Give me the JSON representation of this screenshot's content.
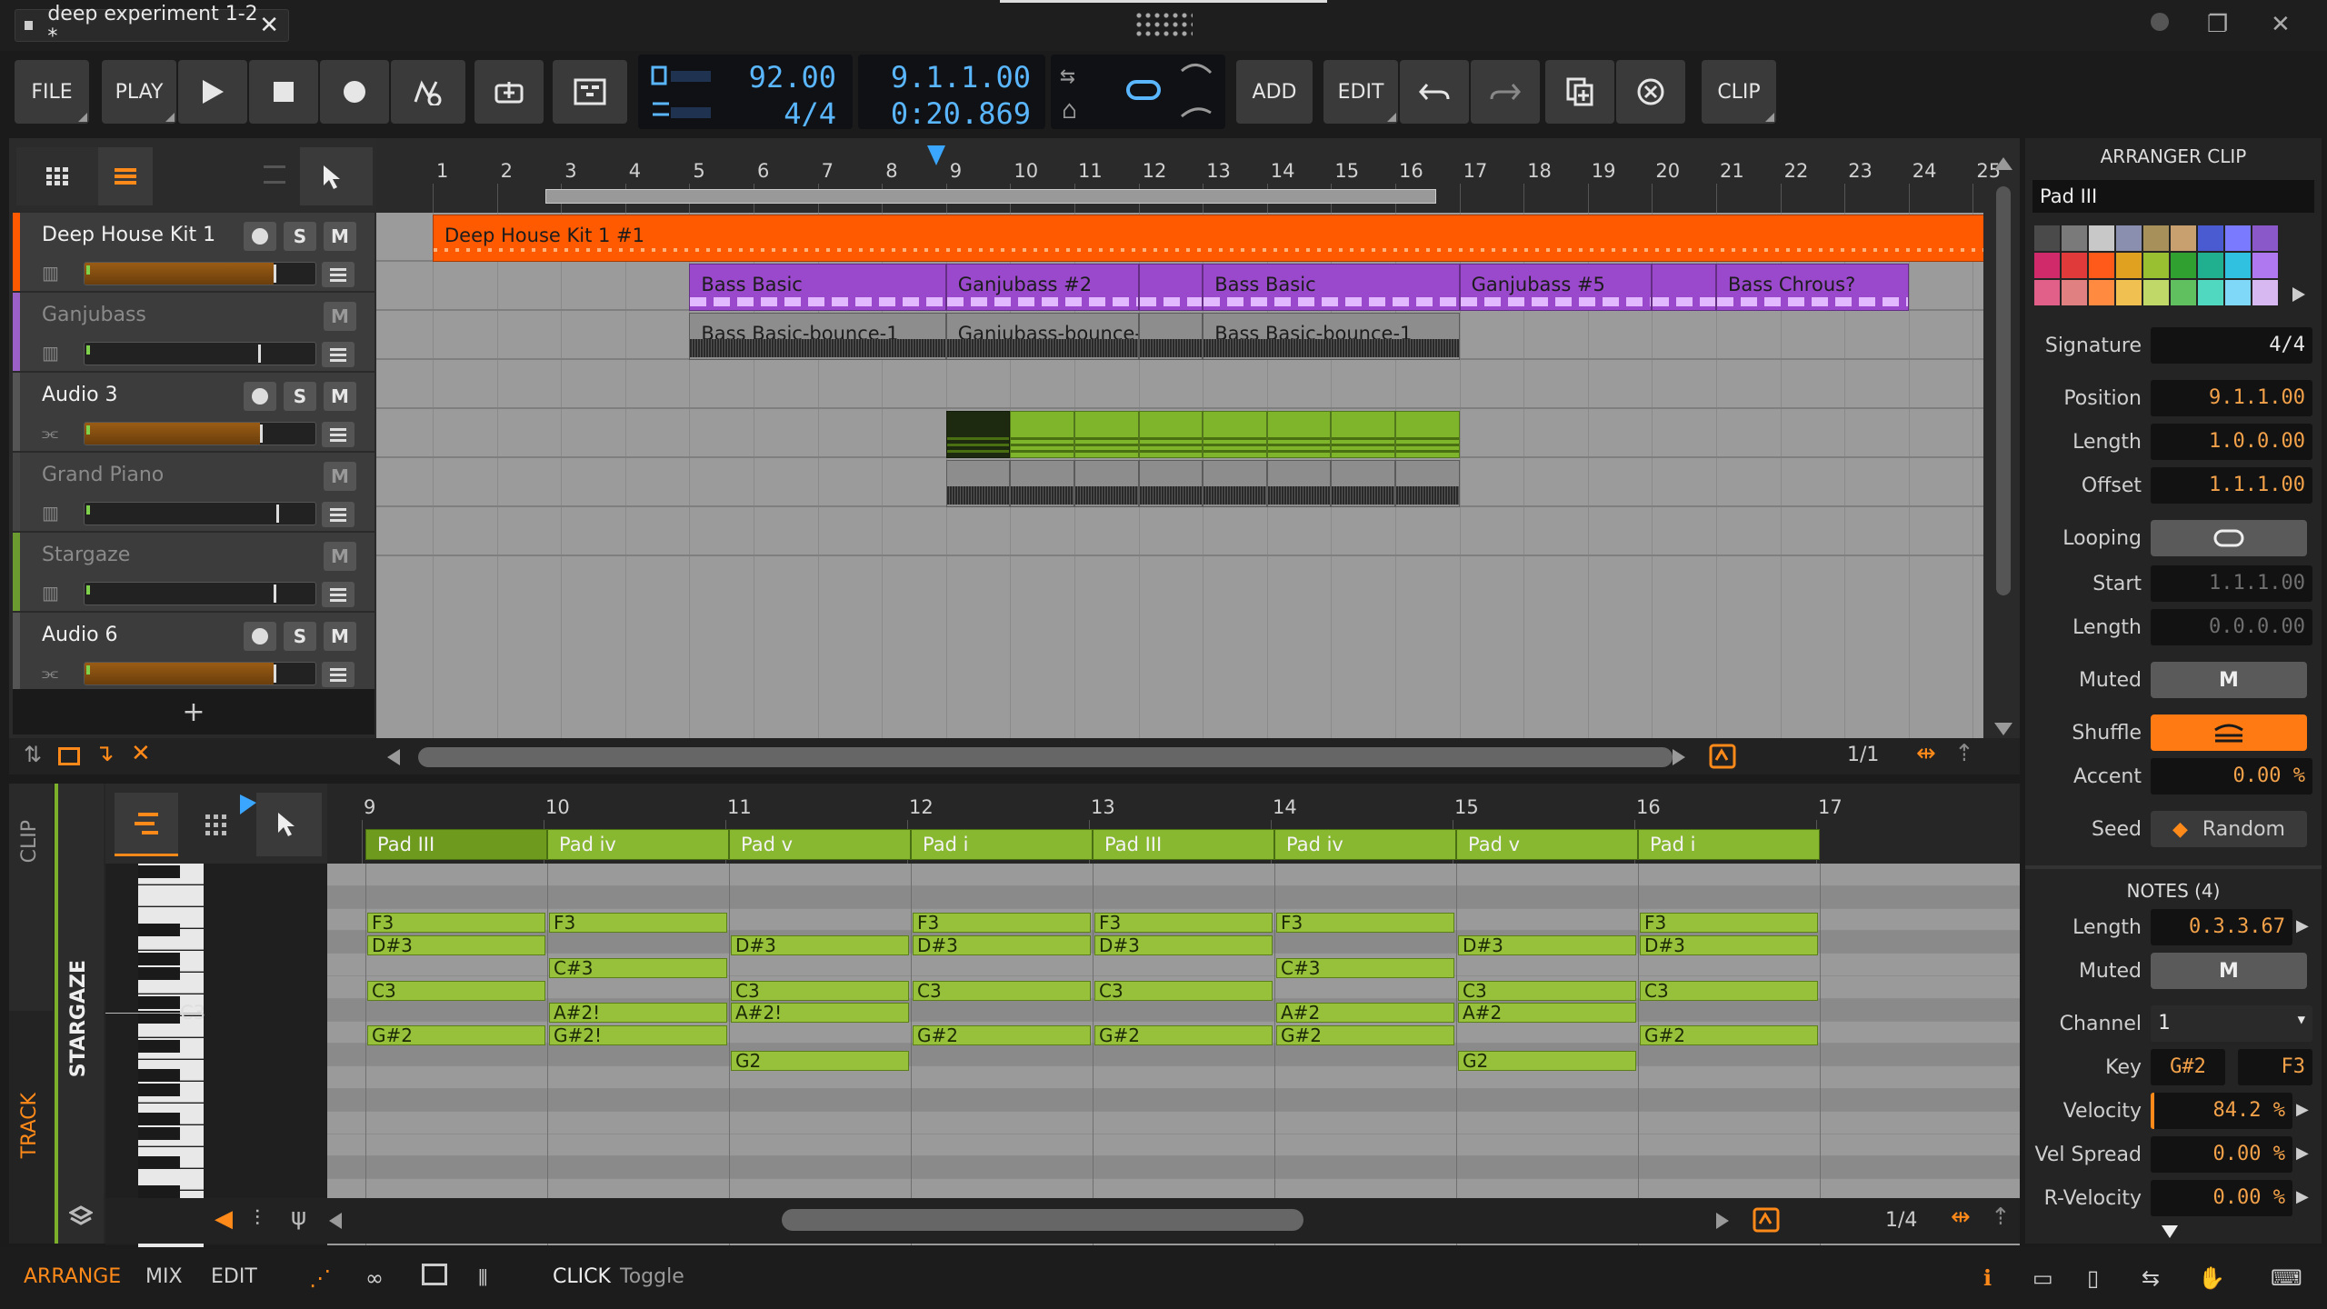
{
  "window": {
    "tab_title": "deep experiment 1-2 *"
  },
  "toolbar": {
    "file": "FILE",
    "play": "PLAY",
    "add": "ADD",
    "edit": "EDIT",
    "clip": "CLIP",
    "tempo": "92.00",
    "signature": "4/4",
    "position": "9.1.1.00",
    "time": "0:20.869"
  },
  "tracks": [
    {
      "name": "Deep House Kit 1",
      "color": "#ff5a00",
      "active": true,
      "rec": true,
      "solo": true,
      "meter": 0.82
    },
    {
      "name": "Ganjubass",
      "color": "#9a60c8",
      "active": false,
      "rec": false,
      "solo": false,
      "meter": 0.75
    },
    {
      "name": "Audio 3",
      "color": "#555555",
      "active": true,
      "rec": true,
      "solo": true,
      "meter": 0.76
    },
    {
      "name": "Grand Piano",
      "color": "#444444",
      "active": false,
      "rec": false,
      "solo": false,
      "meter": 0.83
    },
    {
      "name": "Stargaze",
      "color": "#6a9a30",
      "active": false,
      "rec": false,
      "solo": false,
      "meter": 0.82
    },
    {
      "name": "Audio 6",
      "color": "#555555",
      "active": true,
      "rec": true,
      "solo": true,
      "meter": 0.82
    }
  ],
  "track_buttons": {
    "rec": "",
    "solo": "S",
    "mute": "M",
    "add": "+"
  },
  "ruler": [
    "1",
    "2",
    "3",
    "4",
    "5",
    "6",
    "7",
    "8",
    "9",
    "10",
    "11",
    "12",
    "13",
    "14",
    "15",
    "16",
    "17",
    "18",
    "19",
    "20",
    "21",
    "22",
    "23",
    "24",
    "25"
  ],
  "clips": [
    {
      "label": "Deep House Kit 1 #1"
    },
    {
      "label": "Bass Basic"
    },
    {
      "label": "Ganjubass #2"
    },
    {
      "label": "Bass Basic"
    },
    {
      "label": "Ganjubass #5"
    },
    {
      "label": "Bass Chrous?"
    },
    {
      "label": "Bass Basic-bounce-1"
    },
    {
      "label": "Ganjubass-bounce-"
    },
    {
      "label": "Bass Basic-bounce-1"
    }
  ],
  "arranger_footer": {
    "zoom": "1/1"
  },
  "editor": {
    "tabs": {
      "clip": "CLIP",
      "track": "TRACK",
      "track_name": "STARGAZE"
    },
    "ruler": [
      "9",
      "10",
      "11",
      "12",
      "13",
      "14",
      "15",
      "16",
      "17"
    ],
    "c3_label": "C3",
    "zoom": "1/4",
    "clips": [
      "Pad III",
      "Pad iv",
      "Pad v",
      "Pad i",
      "Pad III",
      "Pad iv",
      "Pad v",
      "Pad i"
    ],
    "notes": [
      {
        "p": "F3",
        "l": "F3"
      },
      {
        "p": "D#3",
        "l": "D#3"
      },
      {
        "p": "C#3",
        "l": "C#3"
      },
      {
        "p": "C3",
        "l": "C3"
      },
      {
        "p": "A#2",
        "l": "A#2"
      },
      {
        "p": "A#2c",
        "l": "A#2!"
      },
      {
        "p": "G#2",
        "l": "G#2"
      },
      {
        "p": "G#2c",
        "l": "G#2!"
      },
      {
        "p": "G2",
        "l": "G2"
      }
    ]
  },
  "inspector": {
    "header": "ARRANGER CLIP",
    "clip_name": "Pad III",
    "signature_label": "Signature",
    "signature": "4/4",
    "position_label": "Position",
    "position": "9.1.1.00",
    "length_label": "Length",
    "length": "1.0.0.00",
    "offset_label": "Offset",
    "offset": "1.1.1.00",
    "looping_label": "Looping",
    "start_label": "Start",
    "start": "1.1.1.00",
    "loop_length_label": "Length",
    "loop_length": "0.0.0.00",
    "muted_label": "Muted",
    "muted": "M",
    "shuffle_label": "Shuffle",
    "accent_label": "Accent",
    "accent": "0.00 %",
    "seed_label": "Seed",
    "seed": "Random",
    "notes_header": "NOTES (4)",
    "n_length_label": "Length",
    "n_length": "0.3.3.67",
    "n_muted_label": "Muted",
    "n_muted": "M",
    "channel_label": "Channel",
    "channel": "1",
    "key_label": "Key",
    "key_low": "G#2",
    "key_high": "F3",
    "velocity_label": "Velocity",
    "velocity": "84.2 %",
    "vel_spread_label": "Vel Spread",
    "vel_spread": "0.00 %",
    "r_velocity_label": "R-Velocity",
    "r_velocity": "0.00 %"
  },
  "statusbar": {
    "arrange": "ARRANGE",
    "mix": "MIX",
    "edit": "EDIT",
    "click": "CLICK",
    "toggle": "Toggle"
  }
}
